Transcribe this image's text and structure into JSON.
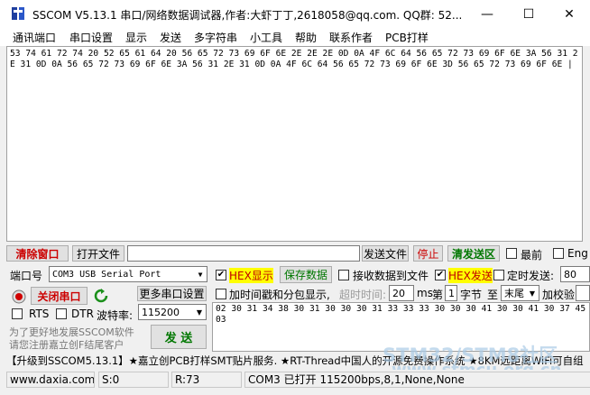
{
  "window": {
    "title": "SSCOM V5.13.1 串口/网络数据调试器,作者:大虾丁丁,2618058@qq.com. QQ群: 52...",
    "minimize": "—",
    "maximize": "☐",
    "close": "✕"
  },
  "menu": [
    "通讯端口",
    "串口设置",
    "显示",
    "发送",
    "多字符串",
    "小工具",
    "帮助",
    "联系作者",
    "PCB打样"
  ],
  "receive_text": "53 74 61 72 74 20 52 65 61 64 20 56 65 72 73 69 6F 6E 2E 2E 2E 0D 0A 4F 6C 64 56 65 72 73 69 6F 6E 3A 56 31 2E 31 0D 0A 56 65 72 73 69 6F 6E 3A 56 31 2E 31 0D 0A 4F 6C 64 56 65 72 73 69 6F 6E 3D 56 65 72 73 69 6F 6E |",
  "row1": {
    "clear_window": "清除窗口",
    "open_file": "打开文件",
    "file_path": "",
    "send_file": "发送文件",
    "stop": "停止",
    "clear_send": "清发送区",
    "last": "最前",
    "eng": "Eng"
  },
  "row2": {
    "port_label": "端口号",
    "port_value": "COM3 USB Serial Port",
    "hex_display": "HEX显示",
    "save_data": "保存数据",
    "recv_to_file": "接收数据到文件",
    "hex_send": "HEX发送",
    "timed_send": "定时发送:",
    "timed_value": "80"
  },
  "row3": {
    "close_port": "关闭串口",
    "more_settings": "更多串口设置",
    "timestamp": "加时间戳和分包显示,",
    "timeout_label": "超时时间:",
    "timeout_value": "20",
    "ms": "ms",
    "index_label": "第",
    "index_value": "1",
    "byte_label": "字节",
    "to_label": "至",
    "end_value": "末尾",
    "checksum": "加校验"
  },
  "row4": {
    "rts": "RTS",
    "dtr": "DTR",
    "baud_label": "波特率:",
    "baud_value": "115200"
  },
  "send_text": "02 30 31 34 38 30 31 30 30 30 31 33 33 33 30 30 30 41 30 30 41 30 37 45 03",
  "promo": {
    "line1": "为了更好地发展SSCOM软件",
    "line2": "请您注册嘉立创F结尾客户",
    "send_button": "发  送"
  },
  "ad_text": "【升级到SSCOM5.13.1】★嘉立创PCB打样SMT贴片服务. ★RT-Thread中国人的开源免费操作系统 ★8KM远距离WiFi可自组",
  "watermark": {
    "line1": "STM32/STM8社区",
    "line2": "www.stmcu.org.cn"
  },
  "status": {
    "website": "www.daxia.com",
    "sent": "S:0",
    "received": "R:73",
    "port_state": "COM3 已打开  115200bps,8,1,None,None"
  }
}
